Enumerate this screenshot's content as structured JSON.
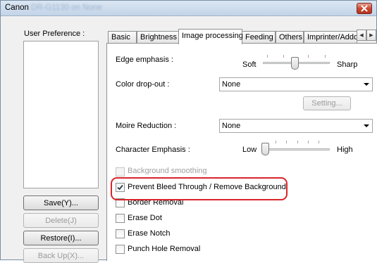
{
  "window": {
    "title_prefix": "Canon",
    "title_blurred": "DR-G1130 on None"
  },
  "left": {
    "label": "User Preference :",
    "buttons": {
      "save": "Save(Y)...",
      "delete": "Delete(J)",
      "restore": "Restore(I)...",
      "backup": "Back Up(X)..."
    }
  },
  "tabs": [
    "Basic",
    "Brightness",
    "Image processing",
    "Feeding",
    "Others",
    "Imprinter/Addo"
  ],
  "active_tab": "Image processing",
  "image_processing": {
    "edge_emphasis": {
      "label": "Edge emphasis :",
      "min_label": "Soft",
      "max_label": "Sharp",
      "value_fraction": 0.5
    },
    "color_dropout": {
      "label": "Color drop-out :",
      "value": "None",
      "setting_button": "Setting..."
    },
    "moire": {
      "label": "Moire Reduction :",
      "value": "None"
    },
    "char_emphasis": {
      "label": "Character Emphasis :",
      "min_label": "Low",
      "max_label": "High",
      "value_fraction": 0.0
    },
    "checkboxes": {
      "background_smoothing": {
        "label": "Background smoothing",
        "checked": false,
        "enabled": false
      },
      "prevent_bleed": {
        "label": "Prevent Bleed Through / Remove Background",
        "checked": true,
        "enabled": true
      },
      "border_removal": {
        "label": "Border Removal",
        "checked": false,
        "enabled": true
      },
      "erase_dot": {
        "label": "Erase Dot",
        "checked": false,
        "enabled": true
      },
      "erase_notch": {
        "label": "Erase Notch",
        "checked": false,
        "enabled": true
      },
      "punch_hole": {
        "label": "Punch Hole Removal",
        "checked": false,
        "enabled": true
      }
    }
  },
  "colors": {
    "highlight": "#d9252a",
    "close_button": "#c94a32"
  }
}
